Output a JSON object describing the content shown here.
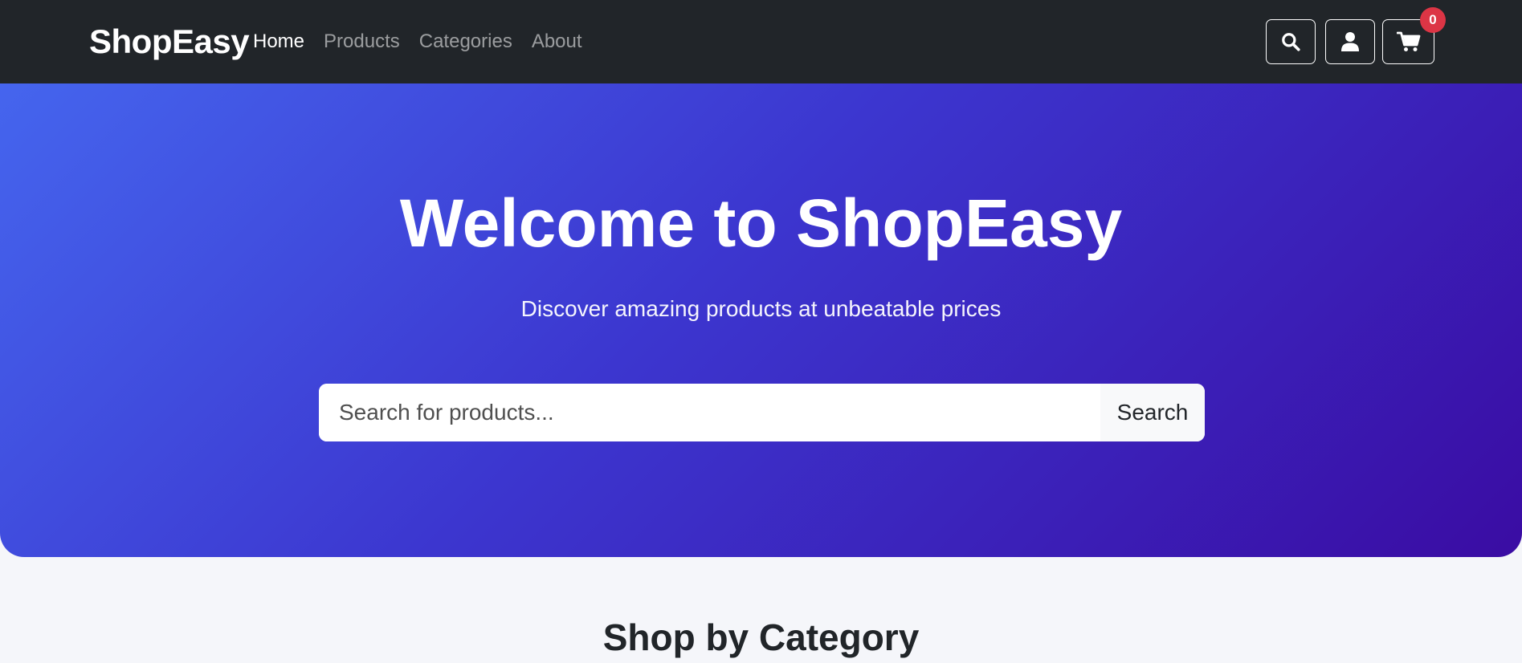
{
  "navbar": {
    "brand": "ShopEasy",
    "links": [
      {
        "label": "Home",
        "active": true
      },
      {
        "label": "Products",
        "active": false
      },
      {
        "label": "Categories",
        "active": false
      },
      {
        "label": "About",
        "active": false
      }
    ],
    "icons": {
      "search": "search-icon",
      "user": "user-icon",
      "cart": "cart-icon"
    },
    "cart_count": "0"
  },
  "hero": {
    "title": "Welcome to ShopEasy",
    "subtitle": "Discover amazing products at unbeatable prices",
    "search": {
      "placeholder": "Search for products...",
      "value": "",
      "button_label": "Search"
    }
  },
  "categories": {
    "heading": "Shop by Category"
  },
  "colors": {
    "navbar_bg": "#212529",
    "hero_gradient_start": "#4565ee",
    "hero_gradient_end": "#3a0ca3",
    "badge": "#dc3545",
    "page_bg": "#f5f6fa"
  }
}
